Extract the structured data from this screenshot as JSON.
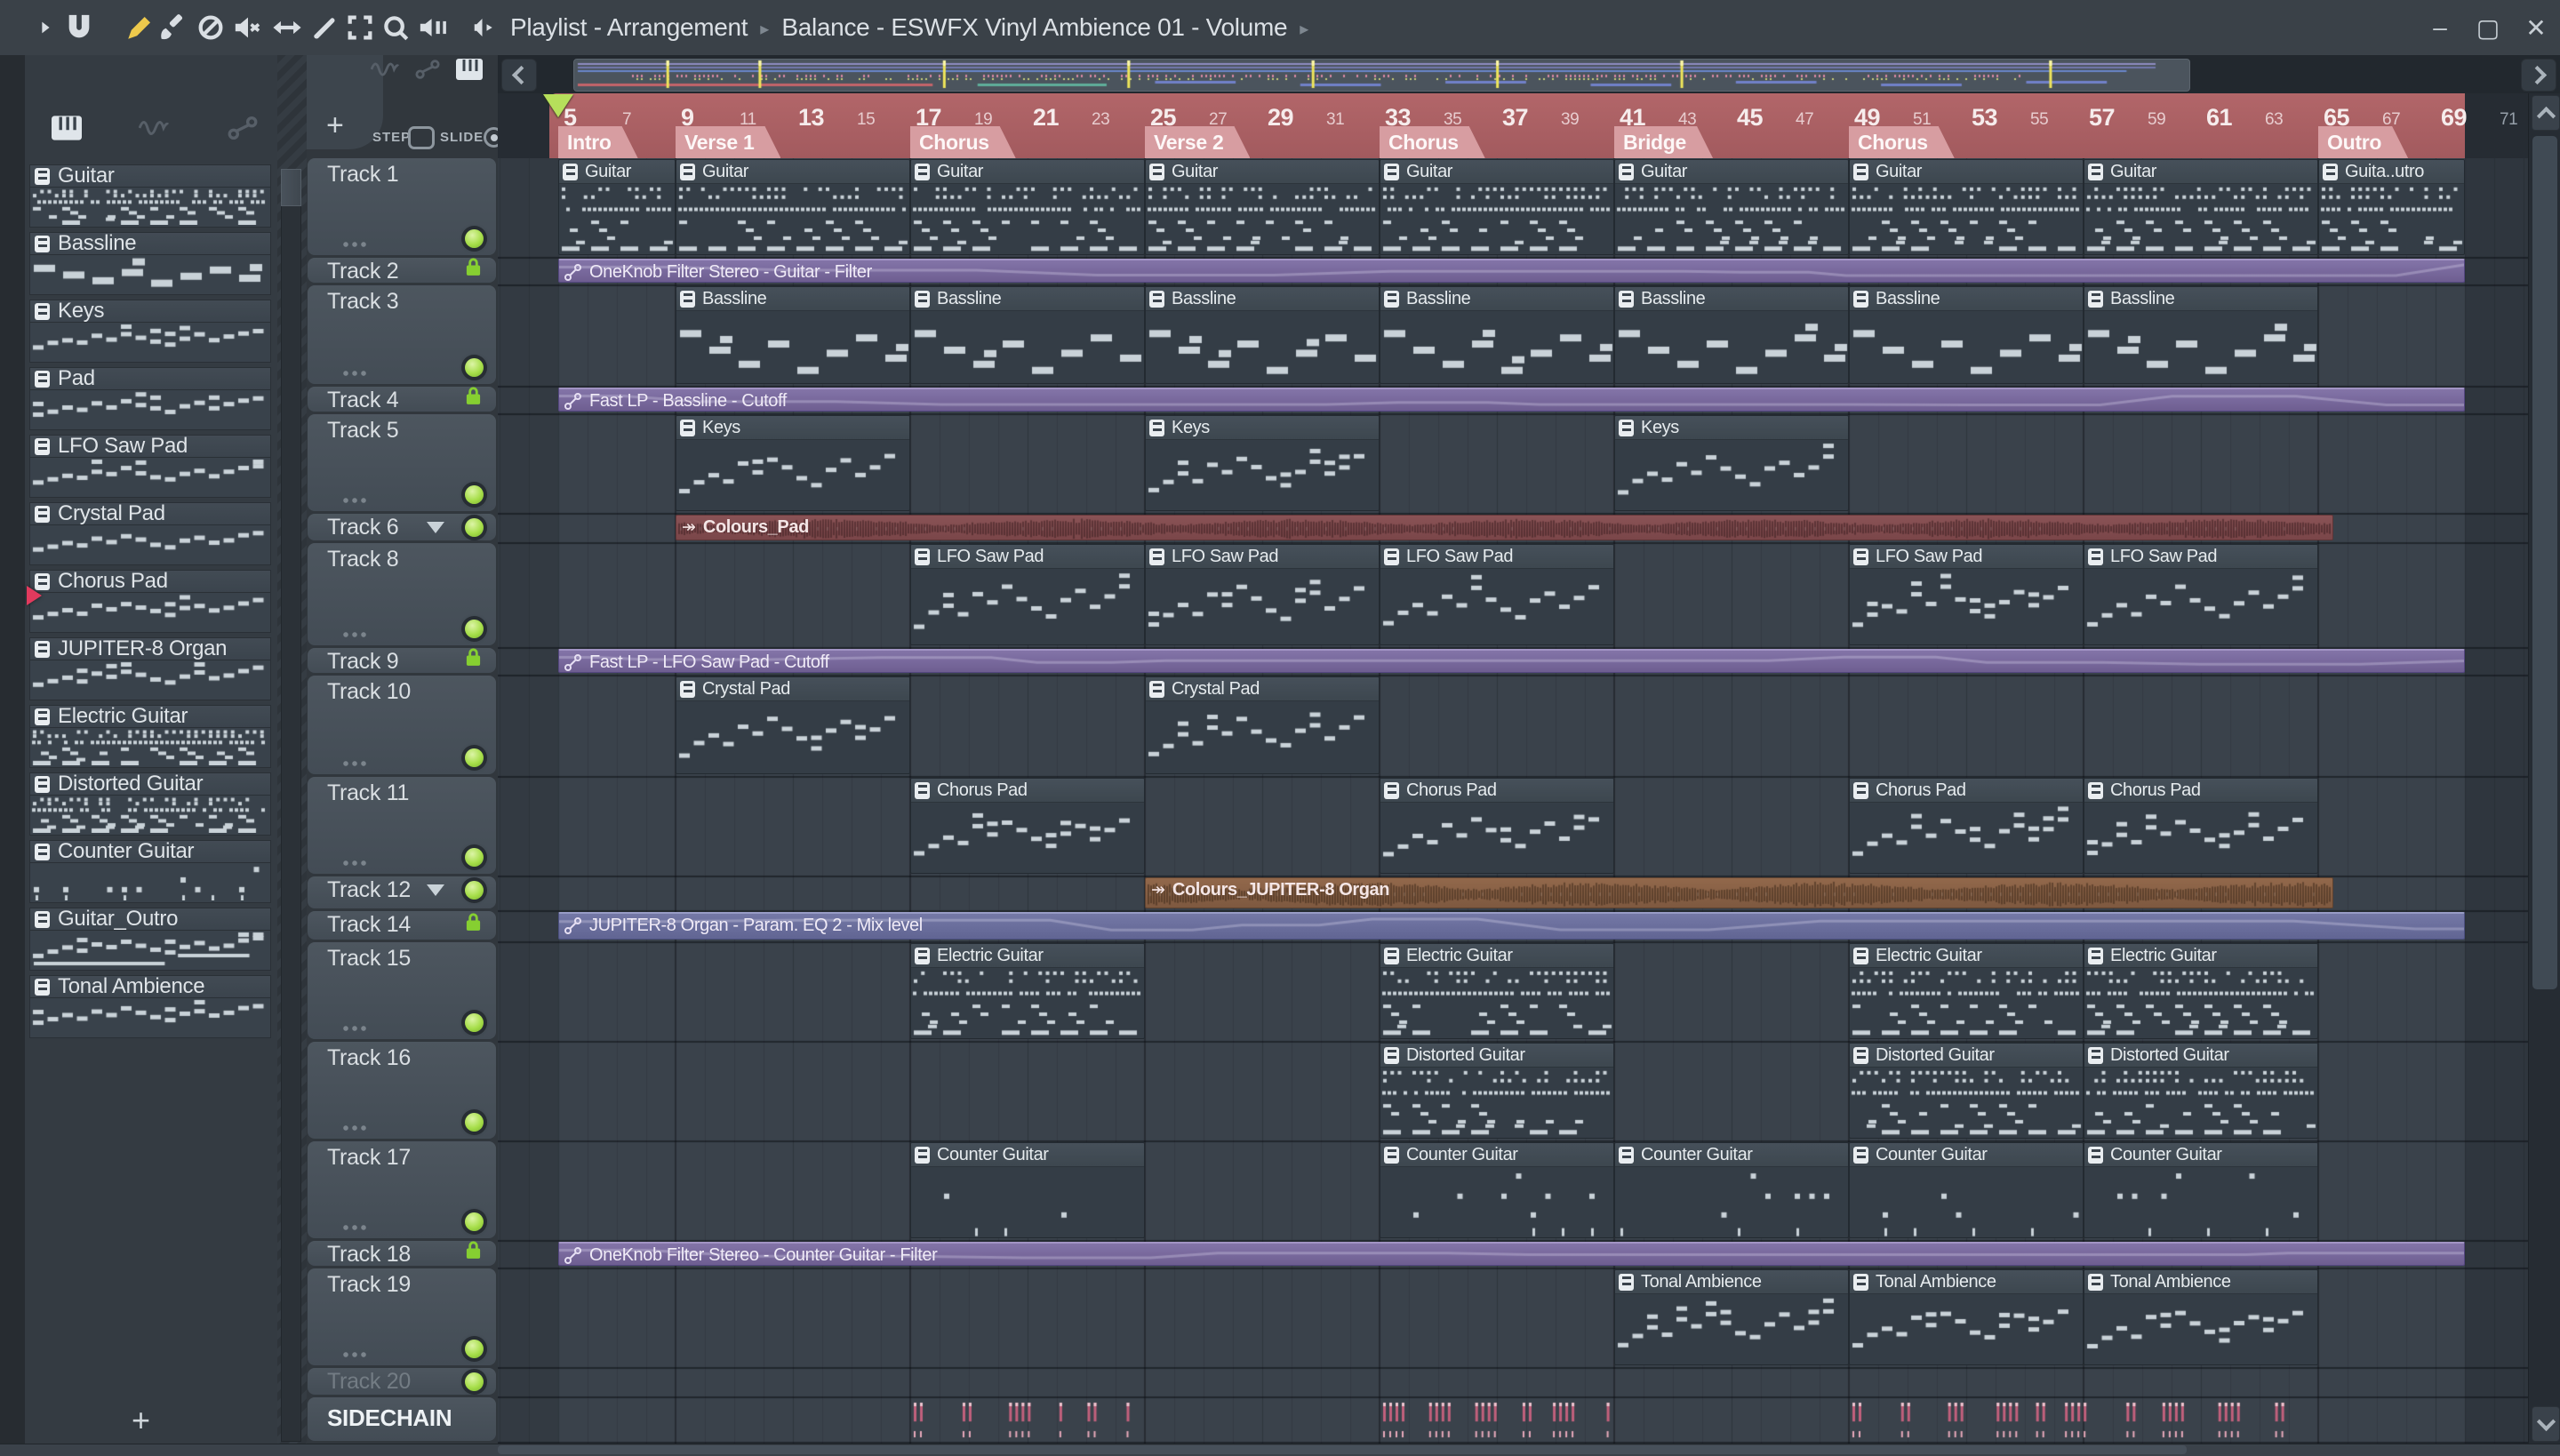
{
  "window": {
    "controls": [
      {
        "name": "minimize",
        "glyph": "–"
      },
      {
        "name": "maximize",
        "glyph": "▢"
      },
      {
        "name": "close",
        "glyph": "✕"
      }
    ]
  },
  "toolbar": {
    "icons": [
      "play-cursor",
      "magnet",
      "draw",
      "paint",
      "delete",
      "mute",
      "slip",
      "slice",
      "select",
      "zoom",
      "playback"
    ],
    "breadcrumb": {
      "icon": "playlist-speaker",
      "parts": [
        "Playlist - Arrangement",
        "Balance - ESWFX Vinyl Ambience 01 - Volume"
      ],
      "separator": "▸"
    }
  },
  "picker": {
    "tabs": [
      "piano-roll",
      "audio",
      "automation"
    ],
    "items": [
      {
        "label": "Guitar",
        "preview": "strum"
      },
      {
        "label": "Bassline",
        "preview": "bass"
      },
      {
        "label": "Keys",
        "preview": "melodic"
      },
      {
        "label": "Pad",
        "preview": "melodic"
      },
      {
        "label": "LFO Saw Pad",
        "preview": "melodic"
      },
      {
        "label": "Crystal Pad",
        "preview": "melodic",
        "playing": true
      },
      {
        "label": "Chorus Pad",
        "preview": "melodic"
      },
      {
        "label": "JUPITER-8 Organ",
        "preview": "melodic"
      },
      {
        "label": "Electric Guitar",
        "preview": "strum"
      },
      {
        "label": "Distorted Guitar",
        "preview": "strum"
      },
      {
        "label": "Counter Guitar",
        "preview": "sparse"
      },
      {
        "label": "Guitar_Outro",
        "preview": "outro"
      },
      {
        "label": "Tonal Ambience",
        "preview": "melodic"
      }
    ],
    "add_label": "+"
  },
  "track_panel": {
    "add_label": "+",
    "step_label": "STEP",
    "slide_label": "SLIDE",
    "tracks": [
      {
        "name": "Track 1",
        "h": 112,
        "kind": "tall"
      },
      {
        "name": "Track 2",
        "h": 31,
        "kind": "lock"
      },
      {
        "name": "Track 3",
        "h": 114,
        "kind": "tall"
      },
      {
        "name": "Track 4",
        "h": 31,
        "kind": "lock"
      },
      {
        "name": "Track 5",
        "h": 112,
        "kind": "tall"
      },
      {
        "name": "Track 6",
        "h": 33,
        "kind": "mini-arrow"
      },
      {
        "name": "Track 8",
        "h": 118,
        "kind": "tall"
      },
      {
        "name": "Track 9",
        "h": 31,
        "kind": "lock"
      },
      {
        "name": "Track 10",
        "h": 114,
        "kind": "tall"
      },
      {
        "name": "Track 11",
        "h": 112,
        "kind": "tall"
      },
      {
        "name": "Track 12",
        "h": 39,
        "kind": "mini-arrow"
      },
      {
        "name": "Track 14",
        "h": 35,
        "kind": "lock"
      },
      {
        "name": "Track 15",
        "h": 112,
        "kind": "tall"
      },
      {
        "name": "Track 16",
        "h": 112,
        "kind": "tall"
      },
      {
        "name": "Track 17",
        "h": 112,
        "kind": "tall"
      },
      {
        "name": "Track 18",
        "h": 31,
        "kind": "lock"
      },
      {
        "name": "Track 19",
        "h": 112,
        "kind": "tall"
      },
      {
        "name": "Track 20",
        "h": 33,
        "kind": "mini-dim"
      },
      {
        "name": "SIDECHAIN",
        "h": 52,
        "kind": "label"
      }
    ]
  },
  "ruler": {
    "numbers": [
      5,
      7,
      9,
      11,
      13,
      15,
      17,
      19,
      21,
      23,
      25,
      27,
      29,
      31,
      33,
      35,
      37,
      39,
      41,
      43,
      45,
      47,
      49,
      51,
      53,
      55,
      57,
      59,
      61,
      63,
      65,
      67,
      69
    ],
    "numbers_outside": [
      71
    ],
    "song_start_bar": 5,
    "song_end_bar": 70,
    "sections": [
      {
        "label": "Intro",
        "bar": 5
      },
      {
        "label": "Verse 1",
        "bar": 9
      },
      {
        "label": "Chorus",
        "bar": 17
      },
      {
        "label": "Verse 2",
        "bar": 25
      },
      {
        "label": "Chorus",
        "bar": 33
      },
      {
        "label": "Bridge",
        "bar": 41
      },
      {
        "label": "Chorus",
        "bar": 49
      },
      {
        "label": "Outro",
        "bar": 65
      }
    ]
  },
  "clips": [
    {
      "t": 0,
      "s": 5,
      "e": 9,
      "label": "Guitar",
      "type": "pattern",
      "prev": "strum"
    },
    {
      "t": 0,
      "s": 9,
      "e": 17,
      "label": "Guitar",
      "type": "pattern",
      "prev": "strum"
    },
    {
      "t": 0,
      "s": 17,
      "e": 25,
      "label": "Guitar",
      "type": "pattern",
      "prev": "strum"
    },
    {
      "t": 0,
      "s": 25,
      "e": 33,
      "label": "Guitar",
      "type": "pattern",
      "prev": "strum"
    },
    {
      "t": 0,
      "s": 33,
      "e": 41,
      "label": "Guitar",
      "type": "pattern",
      "prev": "strum"
    },
    {
      "t": 0,
      "s": 41,
      "e": 49,
      "label": "Guitar",
      "type": "pattern",
      "prev": "strum"
    },
    {
      "t": 0,
      "s": 49,
      "e": 57,
      "label": "Guitar",
      "type": "pattern",
      "prev": "strum"
    },
    {
      "t": 0,
      "s": 57,
      "e": 65,
      "label": "Guitar",
      "type": "pattern",
      "prev": "strum"
    },
    {
      "t": 0,
      "s": 65,
      "e": 70,
      "label": "Guita..utro",
      "type": "pattern",
      "prev": "strum"
    },
    {
      "t": 1,
      "s": 5,
      "e": 70,
      "label": "OneKnob Filter Stereo - Guitar - Filter",
      "type": "auto",
      "variant": "purple"
    },
    {
      "t": 2,
      "s": 9,
      "e": 17,
      "label": "Bassline",
      "type": "pattern",
      "prev": "bass"
    },
    {
      "t": 2,
      "s": 17,
      "e": 25,
      "label": "Bassline",
      "type": "pattern",
      "prev": "bass"
    },
    {
      "t": 2,
      "s": 25,
      "e": 33,
      "label": "Bassline",
      "type": "pattern",
      "prev": "bass"
    },
    {
      "t": 2,
      "s": 33,
      "e": 41,
      "label": "Bassline",
      "type": "pattern",
      "prev": "bass"
    },
    {
      "t": 2,
      "s": 41,
      "e": 49,
      "label": "Bassline",
      "type": "pattern",
      "prev": "bass"
    },
    {
      "t": 2,
      "s": 49,
      "e": 57,
      "label": "Bassline",
      "type": "pattern",
      "prev": "bass"
    },
    {
      "t": 2,
      "s": 57,
      "e": 65,
      "label": "Bassline",
      "type": "pattern",
      "prev": "bass"
    },
    {
      "t": 3,
      "s": 5,
      "e": 70,
      "label": "Fast LP - Bassline - Cutoff",
      "type": "auto",
      "variant": "purple"
    },
    {
      "t": 4,
      "s": 9,
      "e": 17,
      "label": "Keys",
      "type": "pattern",
      "prev": "melodic"
    },
    {
      "t": 4,
      "s": 25,
      "e": 33,
      "label": "Keys",
      "type": "pattern",
      "prev": "melodic"
    },
    {
      "t": 4,
      "s": 41,
      "e": 49,
      "label": "Keys",
      "type": "pattern",
      "prev": "melodic"
    },
    {
      "t": 5,
      "s": 9,
      "e": 65.5,
      "label": "Colours_Pad",
      "type": "audio",
      "variant": "red"
    },
    {
      "t": 6,
      "s": 17,
      "e": 25,
      "label": "LFO Saw Pad",
      "type": "pattern",
      "prev": "melodic"
    },
    {
      "t": 6,
      "s": 25,
      "e": 33,
      "label": "LFO Saw Pad",
      "type": "pattern",
      "prev": "melodic"
    },
    {
      "t": 6,
      "s": 33,
      "e": 41,
      "label": "LFO Saw Pad",
      "type": "pattern",
      "prev": "melodic"
    },
    {
      "t": 6,
      "s": 49,
      "e": 57,
      "label": "LFO Saw Pad",
      "type": "pattern",
      "prev": "melodic"
    },
    {
      "t": 6,
      "s": 57,
      "e": 65,
      "label": "LFO Saw Pad",
      "type": "pattern",
      "prev": "melodic"
    },
    {
      "t": 7,
      "s": 5,
      "e": 70,
      "label": "Fast LP - LFO Saw Pad - Cutoff",
      "type": "auto",
      "variant": "purple"
    },
    {
      "t": 8,
      "s": 9,
      "e": 17,
      "label": "Crystal Pad",
      "type": "pattern",
      "prev": "melodic"
    },
    {
      "t": 8,
      "s": 25,
      "e": 33,
      "label": "Crystal Pad",
      "type": "pattern",
      "prev": "melodic"
    },
    {
      "t": 9,
      "s": 17,
      "e": 25,
      "label": "Chorus Pad",
      "type": "pattern",
      "prev": "melodic"
    },
    {
      "t": 9,
      "s": 33,
      "e": 41,
      "label": "Chorus Pad",
      "type": "pattern",
      "prev": "melodic"
    },
    {
      "t": 9,
      "s": 49,
      "e": 57,
      "label": "Chorus Pad",
      "type": "pattern",
      "prev": "melodic"
    },
    {
      "t": 9,
      "s": 57,
      "e": 65,
      "label": "Chorus Pad",
      "type": "pattern",
      "prev": "melodic"
    },
    {
      "t": 10,
      "s": 25,
      "e": 65.5,
      "label": "Colours_JUPITER-8 Organ",
      "type": "audio",
      "variant": "brown"
    },
    {
      "t": 11,
      "s": 5,
      "e": 70,
      "label": "JUPITER-8 Organ - Param. EQ 2 - Mix level",
      "type": "auto",
      "variant": "blue"
    },
    {
      "t": 12,
      "s": 17,
      "e": 25,
      "label": "Electric Guitar",
      "type": "pattern",
      "prev": "strum"
    },
    {
      "t": 12,
      "s": 33,
      "e": 41,
      "label": "Electric Guitar",
      "type": "pattern",
      "prev": "strum"
    },
    {
      "t": 12,
      "s": 49,
      "e": 57,
      "label": "Electric Guitar",
      "type": "pattern",
      "prev": "strum"
    },
    {
      "t": 12,
      "s": 57,
      "e": 65,
      "label": "Electric Guitar",
      "type": "pattern",
      "prev": "strum"
    },
    {
      "t": 13,
      "s": 33,
      "e": 41,
      "label": "Distorted Guitar",
      "type": "pattern",
      "prev": "strum"
    },
    {
      "t": 13,
      "s": 49,
      "e": 57,
      "label": "Distorted Guitar",
      "type": "pattern",
      "prev": "strum"
    },
    {
      "t": 13,
      "s": 57,
      "e": 65,
      "label": "Distorted Guitar",
      "type": "pattern",
      "prev": "strum"
    },
    {
      "t": 14,
      "s": 17,
      "e": 25,
      "label": "Counter Guitar",
      "type": "pattern",
      "prev": "sparse"
    },
    {
      "t": 14,
      "s": 33,
      "e": 41,
      "label": "Counter Guitar",
      "type": "pattern",
      "prev": "sparse"
    },
    {
      "t": 14,
      "s": 41,
      "e": 49,
      "label": "Counter Guitar",
      "type": "pattern",
      "prev": "sparse"
    },
    {
      "t": 14,
      "s": 49,
      "e": 57,
      "label": "Counter Guitar",
      "type": "pattern",
      "prev": "sparse"
    },
    {
      "t": 14,
      "s": 57,
      "e": 65,
      "label": "Counter Guitar",
      "type": "pattern",
      "prev": "sparse"
    },
    {
      "t": 15,
      "s": 5,
      "e": 70,
      "label": "OneKnob Filter Stereo - Counter Guitar - Filter",
      "type": "auto",
      "variant": "purple"
    },
    {
      "t": 16,
      "s": 41,
      "e": 49,
      "label": "Tonal Ambience",
      "type": "pattern",
      "prev": "melodic"
    },
    {
      "t": 16,
      "s": 49,
      "e": 57,
      "label": "Tonal Ambience",
      "type": "pattern",
      "prev": "melodic"
    },
    {
      "t": 16,
      "s": 57,
      "e": 65,
      "label": "Tonal Ambience",
      "type": "pattern",
      "prev": "melodic"
    },
    {
      "t": 18,
      "s": 17,
      "e": 25,
      "label": "",
      "type": "ticks"
    },
    {
      "t": 18,
      "s": 33,
      "e": 41,
      "label": "",
      "type": "ticks"
    },
    {
      "t": 18,
      "s": 49,
      "e": 65,
      "label": "",
      "type": "ticks"
    }
  ],
  "colors": {
    "ruler_red": "#aa6164",
    "section_tab": "#d79da1",
    "automation_purple": "#7a6b9d",
    "automation_blue": "#6f73a0",
    "audio_red": "#7f494b",
    "audio_brown": "#8a6148",
    "led_green": "#a8e04c",
    "lock_green": "#86cf31",
    "tick_pink": "#c2607c",
    "playhead_green": "#b6df5b",
    "note_gray": "#c9d2d8"
  }
}
